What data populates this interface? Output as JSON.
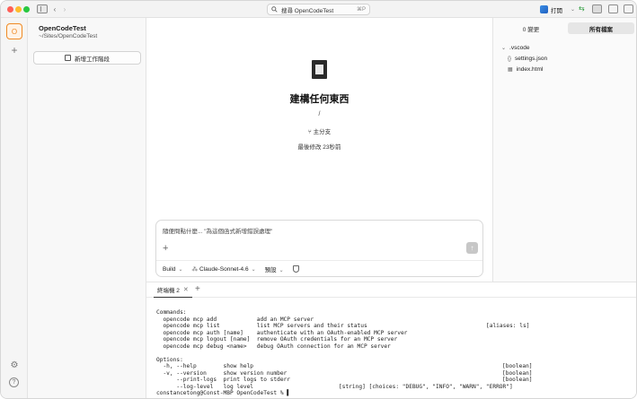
{
  "titlebar": {
    "back_icon": "‹",
    "forward_icon": "›",
    "search_text": "搜尋 OpenCodeTest",
    "search_shortcut": "⌘P",
    "open_label": "打開",
    "git_icon": "⇆"
  },
  "rail": {
    "avatar_label": "O",
    "add_icon": "+",
    "settings_icon": "⚙",
    "help_icon": "?"
  },
  "project": {
    "name": "OpenCodeTest",
    "path": "~/Sites/OpenCodeTest",
    "new_session_label": "新增工作階段"
  },
  "main": {
    "heading": "建構任何東西",
    "directory": "/",
    "branch_icon": "⑂",
    "branch": "主分支",
    "modified": "最後修改 23秒前"
  },
  "composer": {
    "placeholder": "隨便問點什麼... \"為這個函式新增錯誤處理\"",
    "plus_icon": "+",
    "send_icon": "↑",
    "agent": "Build",
    "model": "Claude-Sonnet-4.6",
    "variant": "預設",
    "chevron": "⌄",
    "spark_icon": "⁂"
  },
  "files_panel": {
    "tabs": [
      "0 變更",
      "所有檔案"
    ],
    "active_tab": 1,
    "tree": [
      {
        "label": ".vscode",
        "icon": "⌄"
      },
      {
        "label": "settings.json",
        "icon": "{}"
      },
      {
        "label": "index.html",
        "icon": "▦"
      }
    ]
  },
  "terminal": {
    "tab_label": "終端機 2",
    "close_icon": "✕",
    "add_icon": "+",
    "lines": [
      {
        "left": "Commands:",
        "right": ""
      },
      {
        "left": "  opencode mcp add            add an MCP server",
        "right": ""
      },
      {
        "left": "  opencode mcp list           list MCP servers and their status",
        "right": "[aliases: ls]"
      },
      {
        "left": "  opencode mcp auth [name]    authenticate with an OAuth-enabled MCP server",
        "right": ""
      },
      {
        "left": "  opencode mcp logout [name]  remove OAuth credentials for an MCP server",
        "right": ""
      },
      {
        "left": "  opencode mcp debug <name>   debug OAuth connection for an MCP server",
        "right": ""
      },
      {
        "left": "",
        "right": ""
      },
      {
        "left": "Options:",
        "right": ""
      },
      {
        "left": "  -h, --help        show help",
        "right": "[boolean]"
      },
      {
        "left": "  -v, --version     show version number",
        "right": "[boolean]"
      },
      {
        "left": "      --print-logs  print logs to stderr",
        "right": "[boolean]"
      },
      {
        "left": "      --log-level   log level",
        "right": "[string] [choices: \"DEBUG\", \"INFO\", \"WARN\", \"ERROR\"]"
      },
      {
        "left": "constancetong@Const-MBP OpenCodeTest % ▌",
        "right": ""
      }
    ]
  },
  "colors": {
    "accent": "#f08a24",
    "traffic_red": "#ff5f57",
    "traffic_yellow": "#febc2e",
    "traffic_green": "#28c840"
  }
}
